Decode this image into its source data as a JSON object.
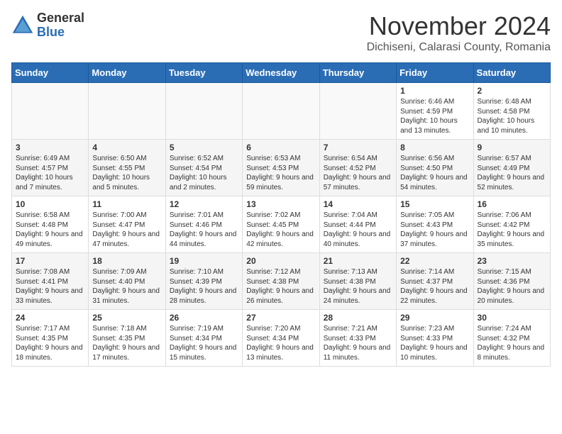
{
  "logo": {
    "general": "General",
    "blue": "Blue"
  },
  "title": "November 2024",
  "location": "Dichiseni, Calarasi County, Romania",
  "days_of_week": [
    "Sunday",
    "Monday",
    "Tuesday",
    "Wednesday",
    "Thursday",
    "Friday",
    "Saturday"
  ],
  "weeks": [
    [
      {
        "day": "",
        "info": ""
      },
      {
        "day": "",
        "info": ""
      },
      {
        "day": "",
        "info": ""
      },
      {
        "day": "",
        "info": ""
      },
      {
        "day": "",
        "info": ""
      },
      {
        "day": "1",
        "info": "Sunrise: 6:46 AM\nSunset: 4:59 PM\nDaylight: 10 hours and 13 minutes."
      },
      {
        "day": "2",
        "info": "Sunrise: 6:48 AM\nSunset: 4:58 PM\nDaylight: 10 hours and 10 minutes."
      }
    ],
    [
      {
        "day": "3",
        "info": "Sunrise: 6:49 AM\nSunset: 4:57 PM\nDaylight: 10 hours and 7 minutes."
      },
      {
        "day": "4",
        "info": "Sunrise: 6:50 AM\nSunset: 4:55 PM\nDaylight: 10 hours and 5 minutes."
      },
      {
        "day": "5",
        "info": "Sunrise: 6:52 AM\nSunset: 4:54 PM\nDaylight: 10 hours and 2 minutes."
      },
      {
        "day": "6",
        "info": "Sunrise: 6:53 AM\nSunset: 4:53 PM\nDaylight: 9 hours and 59 minutes."
      },
      {
        "day": "7",
        "info": "Sunrise: 6:54 AM\nSunset: 4:52 PM\nDaylight: 9 hours and 57 minutes."
      },
      {
        "day": "8",
        "info": "Sunrise: 6:56 AM\nSunset: 4:50 PM\nDaylight: 9 hours and 54 minutes."
      },
      {
        "day": "9",
        "info": "Sunrise: 6:57 AM\nSunset: 4:49 PM\nDaylight: 9 hours and 52 minutes."
      }
    ],
    [
      {
        "day": "10",
        "info": "Sunrise: 6:58 AM\nSunset: 4:48 PM\nDaylight: 9 hours and 49 minutes."
      },
      {
        "day": "11",
        "info": "Sunrise: 7:00 AM\nSunset: 4:47 PM\nDaylight: 9 hours and 47 minutes."
      },
      {
        "day": "12",
        "info": "Sunrise: 7:01 AM\nSunset: 4:46 PM\nDaylight: 9 hours and 44 minutes."
      },
      {
        "day": "13",
        "info": "Sunrise: 7:02 AM\nSunset: 4:45 PM\nDaylight: 9 hours and 42 minutes."
      },
      {
        "day": "14",
        "info": "Sunrise: 7:04 AM\nSunset: 4:44 PM\nDaylight: 9 hours and 40 minutes."
      },
      {
        "day": "15",
        "info": "Sunrise: 7:05 AM\nSunset: 4:43 PM\nDaylight: 9 hours and 37 minutes."
      },
      {
        "day": "16",
        "info": "Sunrise: 7:06 AM\nSunset: 4:42 PM\nDaylight: 9 hours and 35 minutes."
      }
    ],
    [
      {
        "day": "17",
        "info": "Sunrise: 7:08 AM\nSunset: 4:41 PM\nDaylight: 9 hours and 33 minutes."
      },
      {
        "day": "18",
        "info": "Sunrise: 7:09 AM\nSunset: 4:40 PM\nDaylight: 9 hours and 31 minutes."
      },
      {
        "day": "19",
        "info": "Sunrise: 7:10 AM\nSunset: 4:39 PM\nDaylight: 9 hours and 28 minutes."
      },
      {
        "day": "20",
        "info": "Sunrise: 7:12 AM\nSunset: 4:38 PM\nDaylight: 9 hours and 26 minutes."
      },
      {
        "day": "21",
        "info": "Sunrise: 7:13 AM\nSunset: 4:38 PM\nDaylight: 9 hours and 24 minutes."
      },
      {
        "day": "22",
        "info": "Sunrise: 7:14 AM\nSunset: 4:37 PM\nDaylight: 9 hours and 22 minutes."
      },
      {
        "day": "23",
        "info": "Sunrise: 7:15 AM\nSunset: 4:36 PM\nDaylight: 9 hours and 20 minutes."
      }
    ],
    [
      {
        "day": "24",
        "info": "Sunrise: 7:17 AM\nSunset: 4:35 PM\nDaylight: 9 hours and 18 minutes."
      },
      {
        "day": "25",
        "info": "Sunrise: 7:18 AM\nSunset: 4:35 PM\nDaylight: 9 hours and 17 minutes."
      },
      {
        "day": "26",
        "info": "Sunrise: 7:19 AM\nSunset: 4:34 PM\nDaylight: 9 hours and 15 minutes."
      },
      {
        "day": "27",
        "info": "Sunrise: 7:20 AM\nSunset: 4:34 PM\nDaylight: 9 hours and 13 minutes."
      },
      {
        "day": "28",
        "info": "Sunrise: 7:21 AM\nSunset: 4:33 PM\nDaylight: 9 hours and 11 minutes."
      },
      {
        "day": "29",
        "info": "Sunrise: 7:23 AM\nSunset: 4:33 PM\nDaylight: 9 hours and 10 minutes."
      },
      {
        "day": "30",
        "info": "Sunrise: 7:24 AM\nSunset: 4:32 PM\nDaylight: 9 hours and 8 minutes."
      }
    ]
  ]
}
